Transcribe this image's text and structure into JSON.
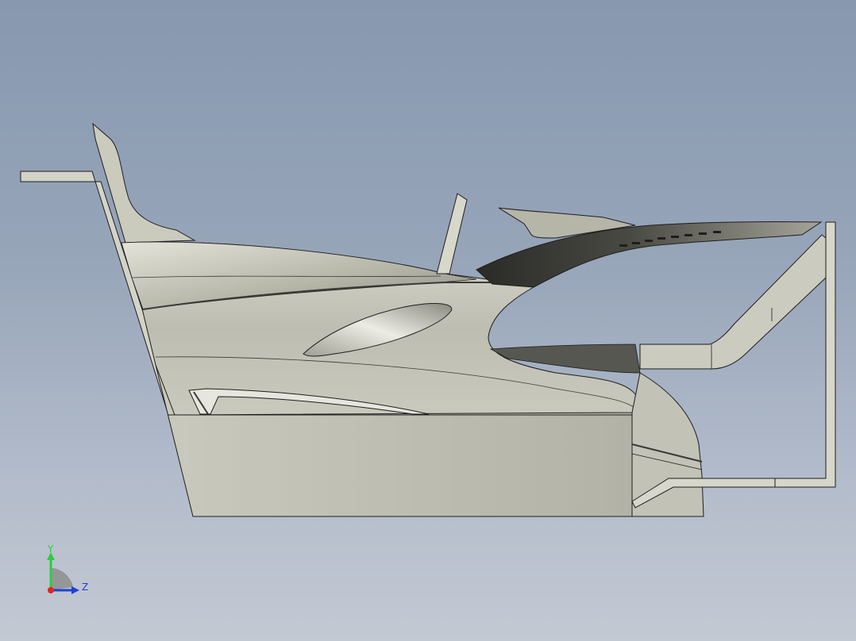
{
  "viewport": {
    "background_top": "#8798af",
    "background_bottom": "#c3c9d3"
  },
  "model": {
    "surface_color": "#c6c6b9",
    "shadow_color": "#3a3a36",
    "edge_color": "#1e1e1e"
  },
  "triad": {
    "y_label": "Y",
    "z_label": "Z",
    "y_color": "#2ecc40",
    "z_color": "#1f3fd6",
    "x_color": "#e0261c"
  }
}
